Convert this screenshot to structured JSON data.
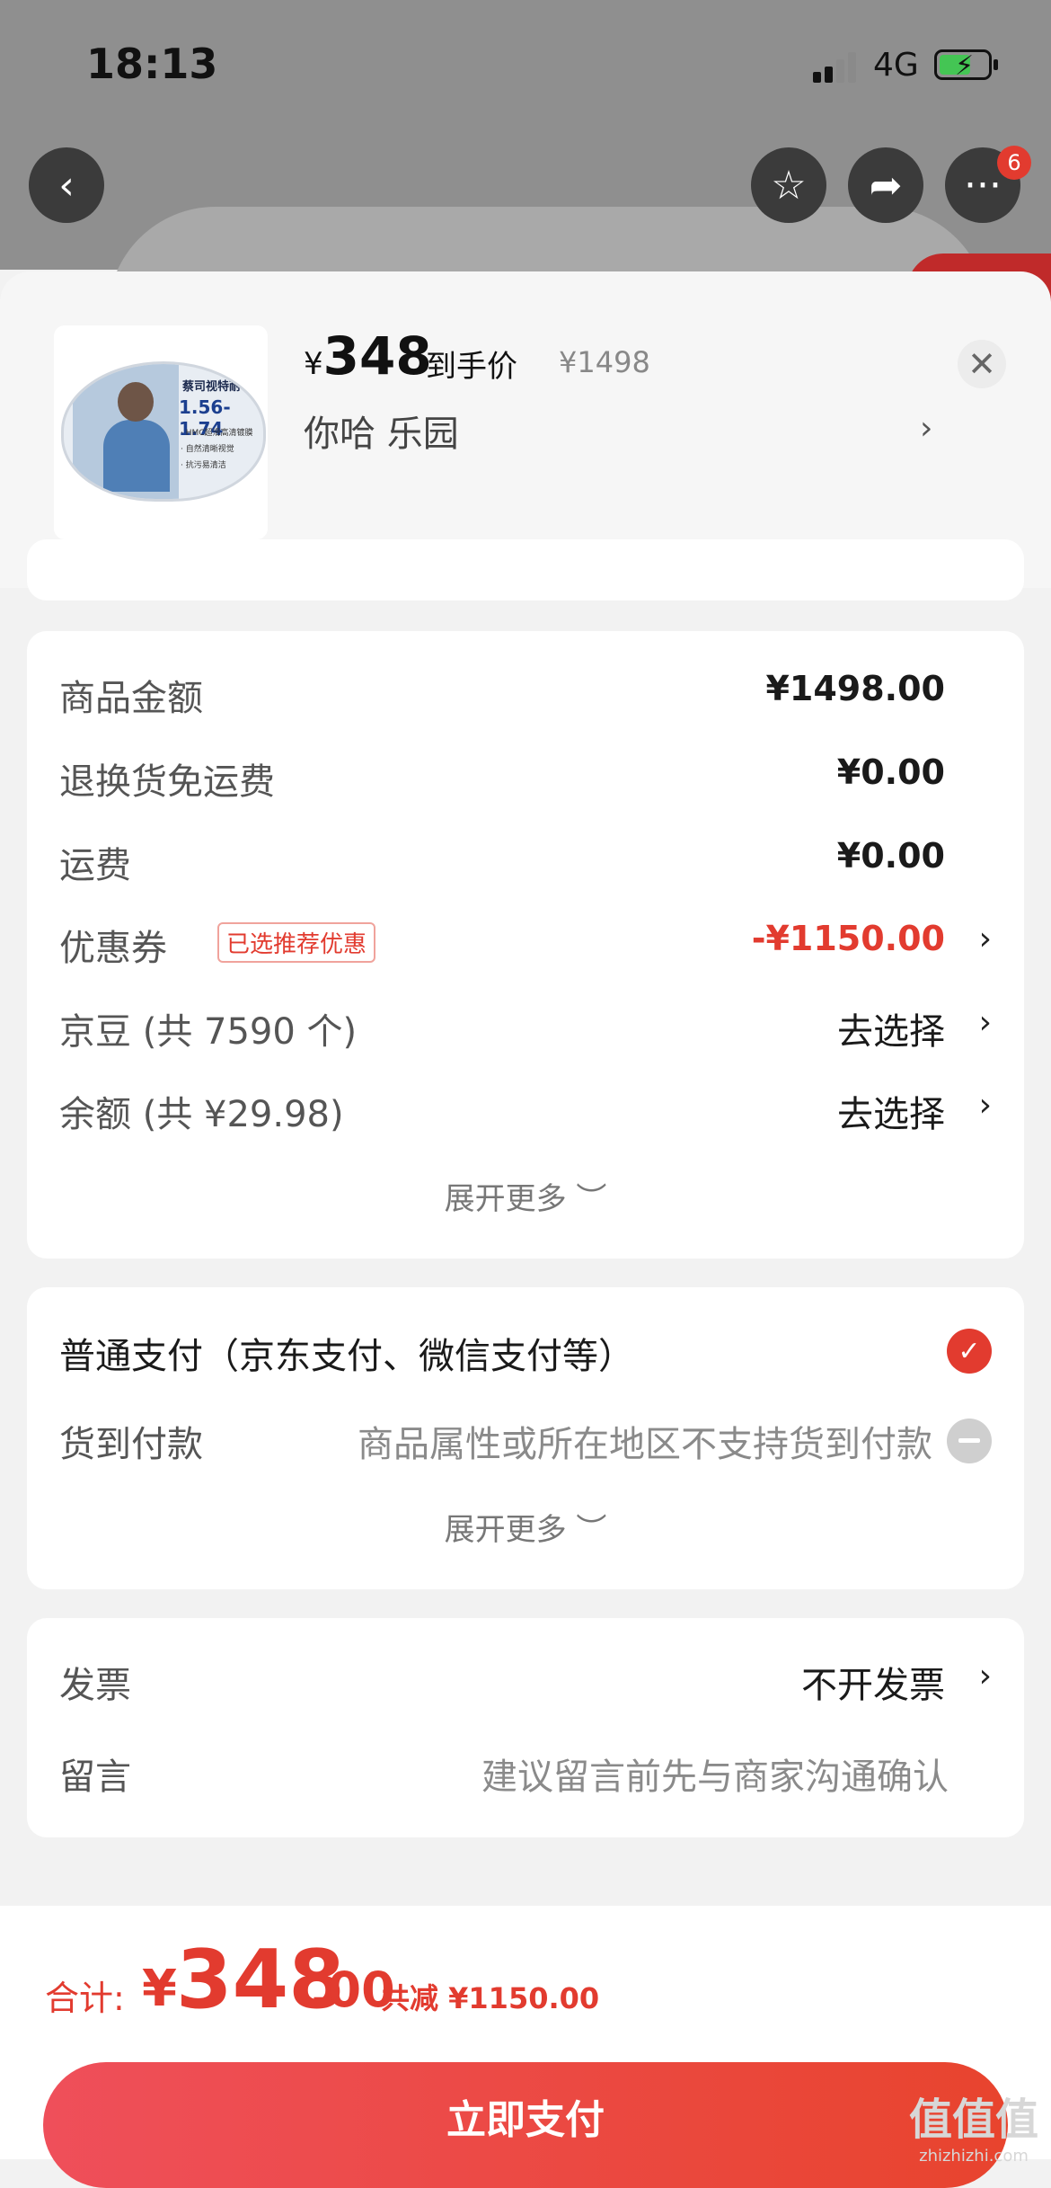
{
  "status_bar": {
    "time": "18:13",
    "network": "4G"
  },
  "top_nav": {
    "back_icon": "chevron-left-icon",
    "favorite_icon": "star-icon",
    "share_icon": "share-arrow-icon",
    "more_icon": "more-dots-icon",
    "more_badge": "6"
  },
  "product": {
    "currency": "¥",
    "price": "348",
    "price_tag": "到手价",
    "original_price": "¥1498",
    "spec": "你哈  乐园",
    "thumbnail_text": {
      "brand": "蔡司视特耐",
      "range": "1.56-1.74",
      "features": [
        "· HMC超滑高清镀膜",
        "· 自然清晰视觉",
        "· 抗污易清洁"
      ]
    }
  },
  "summary": {
    "rows": [
      {
        "label": "商品金额",
        "value": "¥1498.00"
      },
      {
        "label": "退换货免运费",
        "value": "¥0.00"
      },
      {
        "label": "运费",
        "value": "¥0.00"
      },
      {
        "label": "优惠券",
        "tag": "已选推荐优惠",
        "value": "-¥1150.00"
      },
      {
        "label": "京豆 (共 7590 个)",
        "value": "去选择"
      },
      {
        "label": "余额 (共 ¥29.98)",
        "value": "去选择"
      }
    ],
    "expand_label": "展开更多 ︶"
  },
  "payment": {
    "option_normal": "普通支付（京东支付、微信支付等）",
    "option_cod_label": "货到付款",
    "option_cod_note": "商品属性或所在地区不支持货到付款",
    "expand_label": "展开更多 ︶"
  },
  "extras": {
    "invoice_label": "发票",
    "invoice_value": "不开发票",
    "message_label": "留言",
    "message_placeholder": "建议留言前先与商家沟通确认"
  },
  "footer": {
    "total_label": "合计:",
    "currency": "¥",
    "total_int": "348",
    "total_dec": ".00",
    "saved": "共减 ¥1150.00",
    "pay_button": "立即支付"
  },
  "watermark": {
    "logo": "值值值",
    "site": "zhizhizhi.com"
  },
  "colors": {
    "accent": "#e23b2f",
    "background": "#f2f2f2"
  }
}
